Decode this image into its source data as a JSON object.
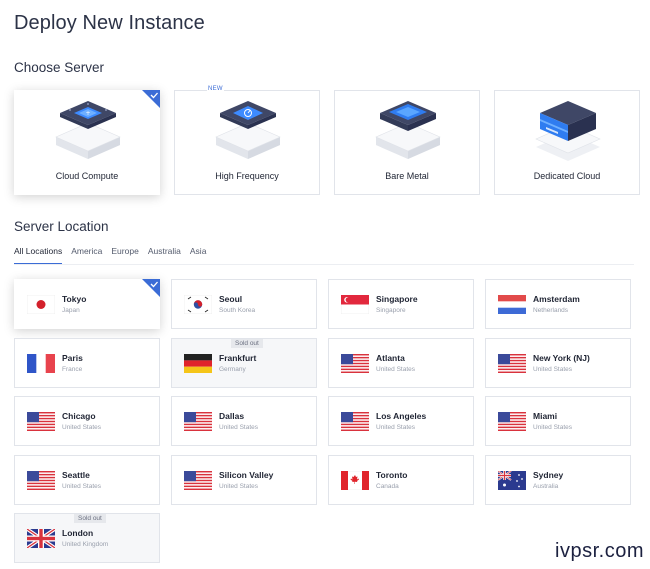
{
  "page": {
    "title": "Deploy New Instance"
  },
  "choose_server": {
    "title": "Choose Server",
    "cards": [
      {
        "label": "Cloud Compute",
        "selected": true,
        "badge": ""
      },
      {
        "label": "High Frequency",
        "selected": false,
        "badge": "NEW"
      },
      {
        "label": "Bare Metal",
        "selected": false,
        "badge": ""
      },
      {
        "label": "Dedicated Cloud",
        "selected": false,
        "badge": ""
      }
    ]
  },
  "server_location": {
    "title": "Server Location",
    "tabs": [
      "All Locations",
      "America",
      "Europe",
      "Australia",
      "Asia"
    ],
    "active_tab": "All Locations",
    "sold_out_label": "Sold out",
    "locations": [
      {
        "city": "Tokyo",
        "country": "Japan",
        "flag": "jp",
        "selected": true,
        "sold_out": false
      },
      {
        "city": "Seoul",
        "country": "South Korea",
        "flag": "kr",
        "selected": false,
        "sold_out": false
      },
      {
        "city": "Singapore",
        "country": "Singapore",
        "flag": "sg",
        "selected": false,
        "sold_out": false
      },
      {
        "city": "Amsterdam",
        "country": "Netherlands",
        "flag": "nl",
        "selected": false,
        "sold_out": false
      },
      {
        "city": "Paris",
        "country": "France",
        "flag": "fr",
        "selected": false,
        "sold_out": false
      },
      {
        "city": "Frankfurt",
        "country": "Germany",
        "flag": "de",
        "selected": false,
        "sold_out": true
      },
      {
        "city": "Atlanta",
        "country": "United States",
        "flag": "us",
        "selected": false,
        "sold_out": false
      },
      {
        "city": "New York (NJ)",
        "country": "United States",
        "flag": "us",
        "selected": false,
        "sold_out": false
      },
      {
        "city": "Chicago",
        "country": "United States",
        "flag": "us",
        "selected": false,
        "sold_out": false
      },
      {
        "city": "Dallas",
        "country": "United States",
        "flag": "us",
        "selected": false,
        "sold_out": false
      },
      {
        "city": "Los Angeles",
        "country": "United States",
        "flag": "us",
        "selected": false,
        "sold_out": false
      },
      {
        "city": "Miami",
        "country": "United States",
        "flag": "us",
        "selected": false,
        "sold_out": false
      },
      {
        "city": "Seattle",
        "country": "United States",
        "flag": "us",
        "selected": false,
        "sold_out": false
      },
      {
        "city": "Silicon Valley",
        "country": "United States",
        "flag": "us",
        "selected": false,
        "sold_out": false
      },
      {
        "city": "Toronto",
        "country": "Canada",
        "flag": "ca",
        "selected": false,
        "sold_out": false
      },
      {
        "city": "Sydney",
        "country": "Australia",
        "flag": "au",
        "selected": false,
        "sold_out": false
      },
      {
        "city": "London",
        "country": "United Kingdom",
        "flag": "gb",
        "selected": false,
        "sold_out": true
      }
    ]
  },
  "watermark": "ivpsr.com",
  "colors": {
    "accent": "#3b6cd6",
    "check": "#3b6cd6",
    "title": "#2c3347"
  }
}
